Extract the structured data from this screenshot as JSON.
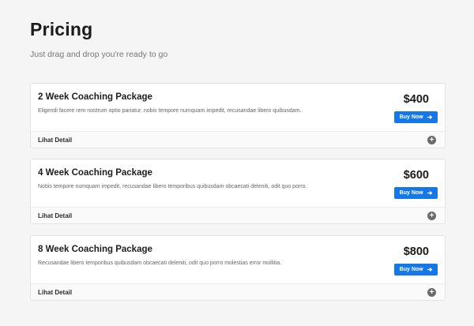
{
  "header": {
    "title": "Pricing",
    "subtitle": "Just drag and drop you're ready to go"
  },
  "packages": [
    {
      "name": "2 Week Coaching Package",
      "description": "Eligendi facere rem nostrum optio pariatur, nobis tempore numquam impedit, recusandae libero quibusdam.",
      "price": "$400",
      "button_label": "Buy Now",
      "detail_label": "Lihat Detail"
    },
    {
      "name": "4 Week Coaching Package",
      "description": "Nobis tempore numquam impedit, recusandae libero temporibus quibusdam obcaecati deleniti, odit quo porro.",
      "price": "$600",
      "button_label": "Buy Now",
      "detail_label": "Lihat Detail"
    },
    {
      "name": "8 Week Coaching Package",
      "description": "Recusandae libero temporibus quibusdam obcaecati deleniti, odit quo porro molestias error mollitia.",
      "price": "$800",
      "button_label": "Buy Now",
      "detail_label": "Lihat Detail"
    }
  ],
  "icons": {
    "button_arrow": "arrow-right-icon",
    "expand": "plus-circle-icon"
  },
  "colors": {
    "accent": "#1677e8",
    "background": "#f5f5f6",
    "expand_icon": "#6b6b6b"
  }
}
